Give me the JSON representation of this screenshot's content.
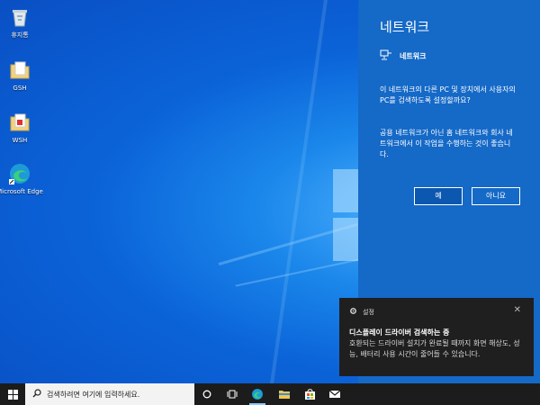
{
  "desktop": {
    "icons": [
      {
        "name": "recycle-bin",
        "label": "휴지통"
      },
      {
        "name": "folder-gsh",
        "label": "GSH"
      },
      {
        "name": "folder-wsh",
        "label": "WSH"
      },
      {
        "name": "edge",
        "label": "Microsoft Edge"
      }
    ]
  },
  "flyout": {
    "title": "네트워크",
    "network_name": "네트워크",
    "question": "이 네트워크의 다른 PC 및 장치에서 사용자의 PC를 검색하도록 설정할까요?",
    "advice": "공용 네트워크가 아닌 홈 네트워크와 회사 네트워크에서 이 작업을 수행하는 것이 좋습니다.",
    "yes_label": "예",
    "no_label": "아니요"
  },
  "toast": {
    "app_name": "설정",
    "heading": "디스플레이 드라이버 검색하는 중",
    "body": "호환되는 드라이버 설치가 완료될 때까지 화면 해상도, 성능, 배터리 사용 시간이 줄어들 수 있습니다.",
    "close_glyph": "✕"
  },
  "taskbar": {
    "search_placeholder": "검색하려면 여기에 입력하세요.",
    "apps": [
      "cortana-icon",
      "task-view-icon",
      "edge-icon",
      "file-explorer-icon",
      "store-icon",
      "mail-icon"
    ]
  },
  "colors": {
    "flyout_bg": "#1569c7",
    "toast_bg": "#1f1f1f",
    "taskbar_bg": "#1c1c1c",
    "accent": "#0c57b0"
  }
}
